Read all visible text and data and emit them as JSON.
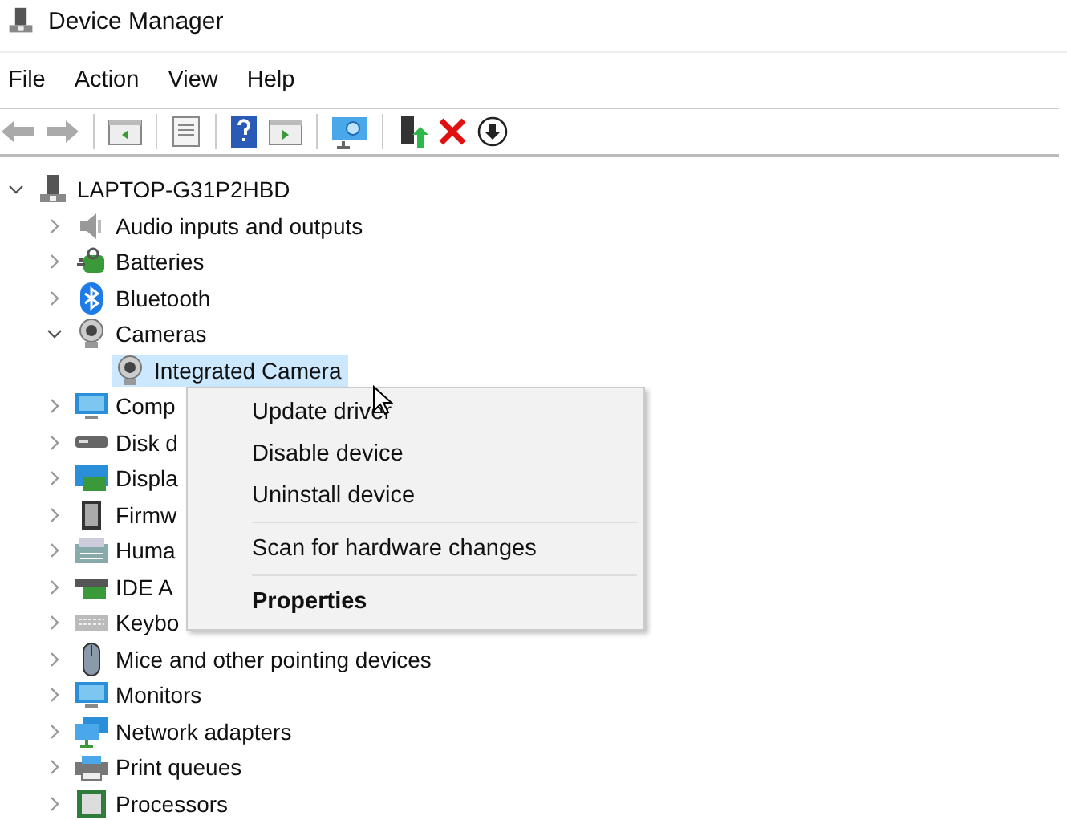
{
  "window": {
    "title": "Device Manager"
  },
  "menu_bar": [
    {
      "label": "File"
    },
    {
      "label": "Action"
    },
    {
      "label": "View"
    },
    {
      "label": "Help"
    }
  ],
  "tree": [
    {
      "label": "LAPTOP-G31P2HBD",
      "expanded": true,
      "selected": false,
      "children": [
        {
          "label": "Audio inputs and outputs",
          "expanded": false,
          "selected": false
        },
        {
          "label": "Batteries",
          "expanded": false,
          "selected": false
        },
        {
          "label": "Bluetooth",
          "expanded": false,
          "selected": false
        },
        {
          "label": "Cameras",
          "expanded": true,
          "selected": false,
          "children": [
            {
              "label": "Integrated Camera",
              "selected": true
            }
          ]
        },
        {
          "label": "Comp",
          "expanded": false,
          "selected": false
        },
        {
          "label": "Disk d",
          "expanded": false,
          "selected": false
        },
        {
          "label": "Displa",
          "expanded": false,
          "selected": false
        },
        {
          "label": "Firmw",
          "expanded": false,
          "selected": false
        },
        {
          "label": "Huma",
          "expanded": false,
          "selected": false
        },
        {
          "label": "IDE A",
          "expanded": false,
          "selected": false
        },
        {
          "label": "Keybo",
          "expanded": false,
          "selected": false
        },
        {
          "label": "Mice and other pointing devices",
          "expanded": false,
          "selected": false
        },
        {
          "label": "Monitors",
          "expanded": false,
          "selected": false
        },
        {
          "label": "Network adapters",
          "expanded": false,
          "selected": false
        },
        {
          "label": "Print queues",
          "expanded": false,
          "selected": false
        },
        {
          "label": "Processors",
          "expanded": false,
          "selected": false
        }
      ]
    }
  ],
  "context_menu": [
    {
      "kind": "item",
      "label": "Update driver"
    },
    {
      "kind": "item",
      "label": "Disable device"
    },
    {
      "kind": "item",
      "label": "Uninstall device"
    },
    {
      "kind": "separator"
    },
    {
      "kind": "item",
      "label": "Scan for hardware changes"
    },
    {
      "kind": "separator"
    },
    {
      "kind": "default",
      "label": "Properties"
    }
  ]
}
